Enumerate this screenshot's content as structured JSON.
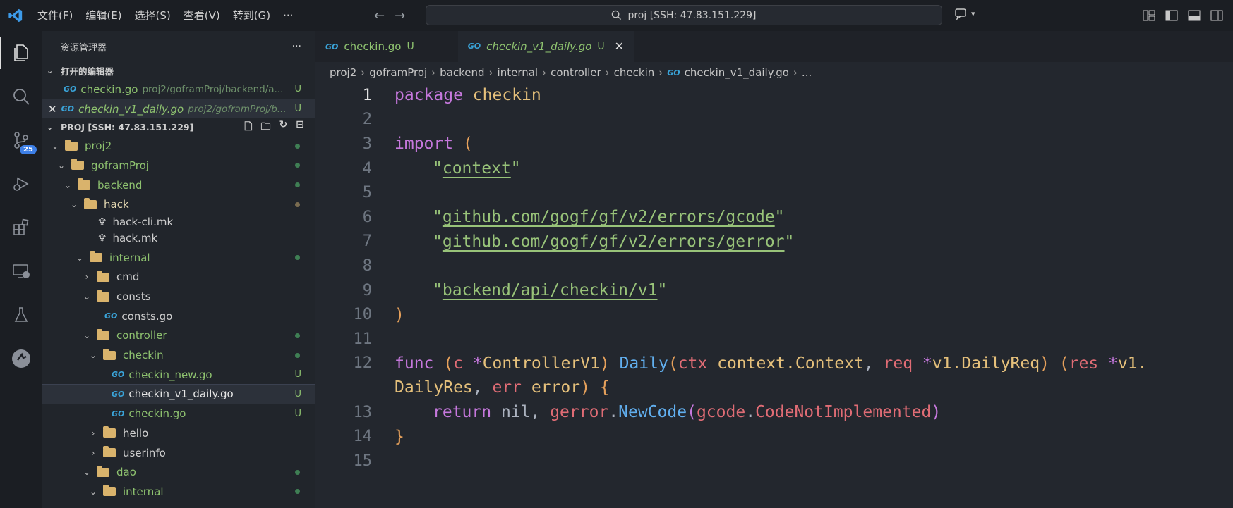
{
  "titlebar": {
    "menus": [
      "文件(F)",
      "编辑(E)",
      "选择(S)",
      "查看(V)",
      "转到(G)",
      "···"
    ],
    "search_text": "proj [SSH: 47.83.151.229]"
  },
  "activity": {
    "scm_badge": "25"
  },
  "sidebar": {
    "title": "资源管理器",
    "more": "···",
    "open_editors_label": "打开的编辑器",
    "open_editors": [
      {
        "name": "checkin.go",
        "path": "proj2/goframProj/backend/a...",
        "status": "U"
      },
      {
        "name": "checkin_v1_daily.go",
        "path": "proj2/goframProj/b...",
        "status": "U"
      }
    ],
    "project_label": "PROJ [SSH: 47.83.151.229]",
    "tree": [
      {
        "label": "proj2"
      },
      {
        "label": "goframProj"
      },
      {
        "label": "backend"
      },
      {
        "label": "hack"
      },
      {
        "label": "hack-cli.mk"
      },
      {
        "label": "hack.mk"
      },
      {
        "label": "internal"
      },
      {
        "label": "cmd"
      },
      {
        "label": "consts"
      },
      {
        "label": "consts.go"
      },
      {
        "label": "controller"
      },
      {
        "label": "checkin"
      },
      {
        "label": "checkin_new.go",
        "status": "U"
      },
      {
        "label": "checkin_v1_daily.go",
        "status": "U"
      },
      {
        "label": "checkin.go",
        "status": "U"
      },
      {
        "label": "hello"
      },
      {
        "label": "userinfo"
      },
      {
        "label": "dao"
      },
      {
        "label": "internal"
      }
    ]
  },
  "tabs": [
    {
      "name": "checkin.go",
      "status": "U"
    },
    {
      "name": "checkin_v1_daily.go",
      "status": "U"
    }
  ],
  "breadcrumb": [
    "proj2",
    "goframProj",
    "backend",
    "internal",
    "controller",
    "checkin",
    "checkin_v1_daily.go",
    "..."
  ],
  "code": {
    "line_numbers": [
      "1",
      "2",
      "3",
      "4",
      "5",
      "6",
      "7",
      "8",
      "9",
      "10",
      "11",
      "12",
      "",
      "13",
      "14",
      "15"
    ],
    "l1": {
      "kw": "package",
      "name": "checkin"
    },
    "l3": {
      "kw": "import",
      "paren": "("
    },
    "l4": "context",
    "l6": "github.com/gogf/gf/v2/errors/gcode",
    "l7": "github.com/gogf/gf/v2/errors/gerror",
    "l9": "backend/api/checkin/v1",
    "l10": ")",
    "l12": {
      "func": "func",
      "recv": "c",
      "recv_type": "ControllerV1",
      "method": "Daily",
      "p1": "ctx",
      "p1_type": "context.Context",
      "p2": "req",
      "p2_type": "v1.DailyReq",
      "r1": "res",
      "r1_type_a": "v1.",
      "r1_type_b": "DailyRes",
      "r2": "err",
      "r2_type": "error"
    },
    "l13": {
      "ret": "return",
      "nil": "nil",
      "pkg": "gerror",
      "fn": "NewCode",
      "arg_pkg": "gcode",
      "arg": "CodeNotImplemented"
    },
    "l14": "}"
  }
}
